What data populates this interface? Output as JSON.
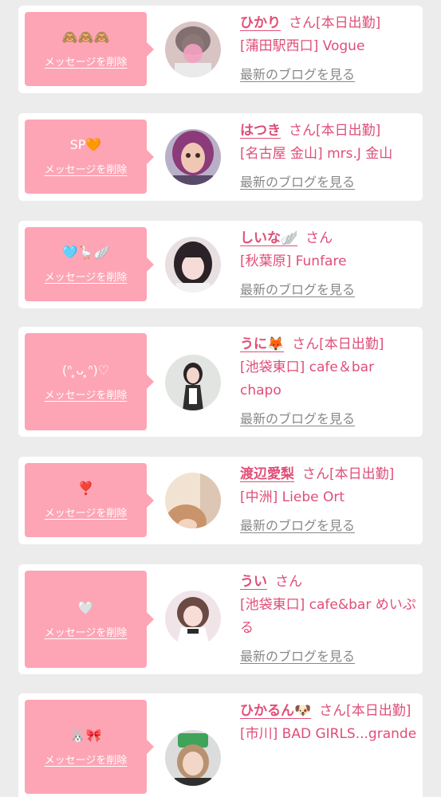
{
  "delete_label": "メッセージを削除",
  "blog_label": "最新のブログを見る",
  "san_label": "さん",
  "cards": [
    {
      "emoji": "🙈🙈🙈",
      "name": "ひかり",
      "suffix": "[本日出勤]",
      "shop": "[蒲田駅西口] Vogue"
    },
    {
      "emoji": "SP🧡",
      "name": "はつき",
      "suffix": "[本日出勤]",
      "shop": "[名古屋 金山] mrs.J 金山"
    },
    {
      "emoji": "🩵🪿🪽",
      "name": "しいな🪽",
      "suffix": "",
      "shop": "[秋葉原] Funfare"
    },
    {
      "emoji": "(ᐢ ̥ᴗ ̥ᐢ)♡",
      "name": "うに🦊",
      "suffix": "[本日出勤]",
      "shop": "[池袋東口] cafe＆bar chapo"
    },
    {
      "emoji": "❣️",
      "name": "渡辺愛梨",
      "suffix": "[本日出勤]",
      "shop": "[中洲] Liebe Ort"
    },
    {
      "emoji": "🤍",
      "name": "うい",
      "suffix": "",
      "shop": "[池袋東口] cafe&bar めいぷる"
    },
    {
      "emoji": "🐰🎀",
      "name": "ひかるん🐶",
      "suffix": "[本日出勤]",
      "shop": "[市川] BAD GIRLS...grande"
    }
  ],
  "colors": {
    "bubble": "#fda5b5",
    "accent": "#e04e78",
    "link_gray": "#888888"
  }
}
